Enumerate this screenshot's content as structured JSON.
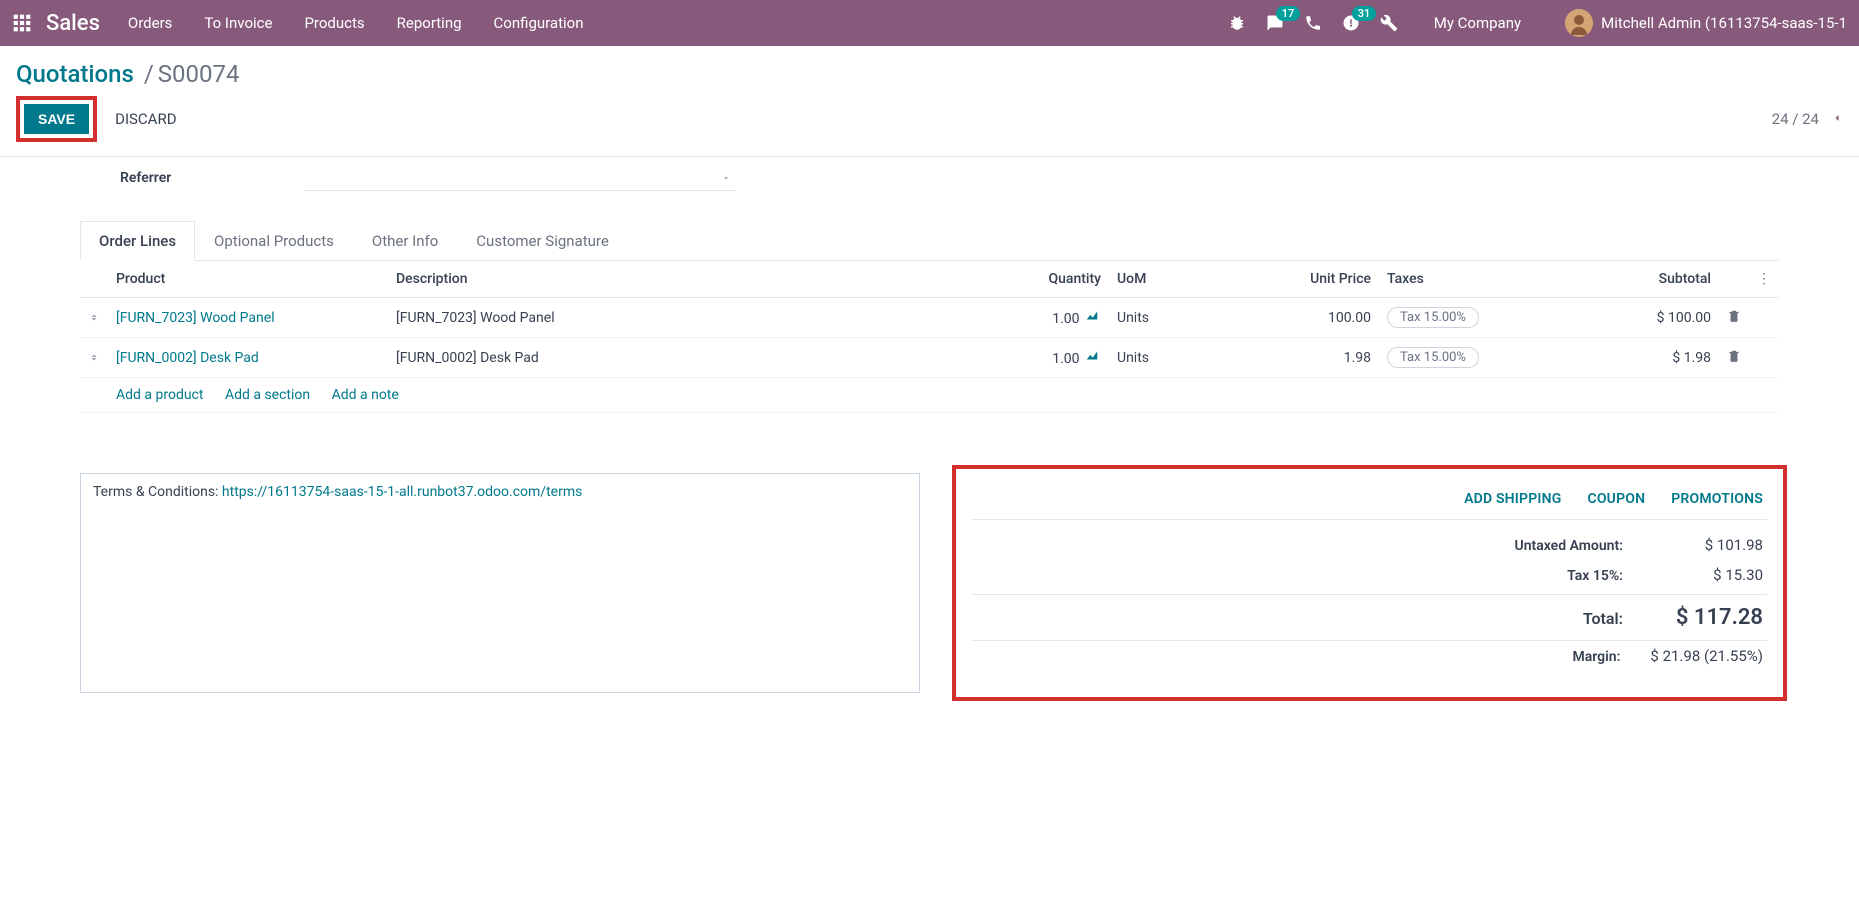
{
  "header": {
    "brand": "Sales",
    "nav": [
      "Orders",
      "To Invoice",
      "Products",
      "Reporting",
      "Configuration"
    ],
    "chat_badge": "17",
    "activity_badge": "31",
    "company": "My Company",
    "user": "Mitchell Admin (16113754-saas-15-1"
  },
  "breadcrumb": {
    "root": "Quotations",
    "leaf": "S00074"
  },
  "actions": {
    "save": "SAVE",
    "discard": "DISCARD",
    "pager": "24 / 24"
  },
  "form": {
    "referrer_label": "Referrer"
  },
  "tabs": [
    "Order Lines",
    "Optional Products",
    "Other Info",
    "Customer Signature"
  ],
  "table": {
    "headers": {
      "product": "Product",
      "description": "Description",
      "quantity": "Quantity",
      "uom": "UoM",
      "unit_price": "Unit Price",
      "taxes": "Taxes",
      "subtotal": "Subtotal"
    },
    "rows": [
      {
        "product": "[FURN_7023] Wood Panel",
        "description": "[FURN_7023] Wood Panel",
        "quantity": "1.00",
        "uom": "Units",
        "unit_price": "100.00",
        "tax": "Tax 15.00%",
        "subtotal": "$ 100.00"
      },
      {
        "product": "[FURN_0002] Desk Pad",
        "description": "[FURN_0002] Desk Pad",
        "quantity": "1.00",
        "uom": "Units",
        "unit_price": "1.98",
        "tax": "Tax 15.00%",
        "subtotal": "$ 1.98"
      }
    ],
    "add": {
      "product": "Add a product",
      "section": "Add a section",
      "note": "Add a note"
    }
  },
  "terms": {
    "prefix": "Terms & Conditions: ",
    "link": "https://16113754-saas-15-1-all.runbot37.odoo.com/terms"
  },
  "totals": {
    "actions": {
      "shipping": "ADD SHIPPING",
      "coupon": "COUPON",
      "promotions": "PROMOTIONS"
    },
    "untaxed_label": "Untaxed Amount:",
    "untaxed_value": "$ 101.98",
    "tax_label": "Tax 15%:",
    "tax_value": "$ 15.30",
    "total_label": "Total:",
    "total_value": "$ 117.28",
    "margin_label": "Margin:",
    "margin_value": "$ 21.98 (21.55%)"
  }
}
